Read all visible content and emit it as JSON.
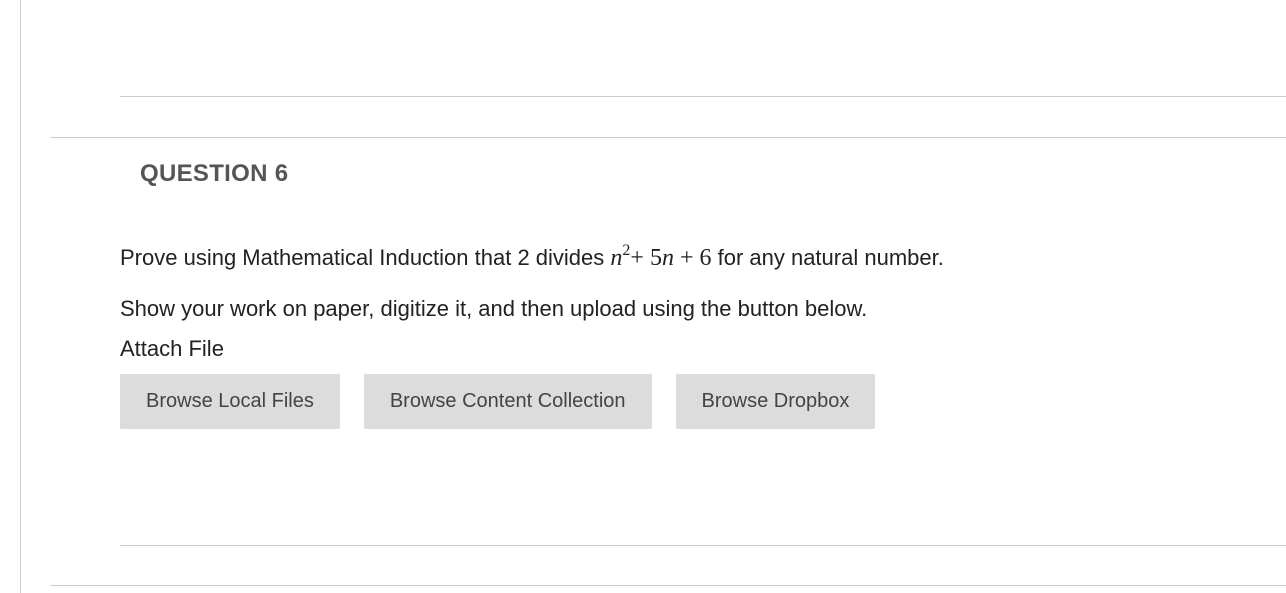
{
  "question": {
    "header": "QUESTION 6",
    "prompt_prefix": "Prove using Mathematical Induction that 2 divides ",
    "expr_n": "n",
    "expr_sup": "2",
    "expr_op1": "+ ",
    "expr_coef": "5",
    "expr_n2": "n",
    "expr_op2": " + ",
    "expr_const": "6",
    "prompt_suffix": " for any natural number.",
    "instruction": "Show your work on paper, digitize it, and then upload using the button below.",
    "attach_label": "Attach File",
    "buttons": {
      "local": "Browse Local Files",
      "content": "Browse Content Collection",
      "dropbox": "Browse Dropbox"
    }
  }
}
